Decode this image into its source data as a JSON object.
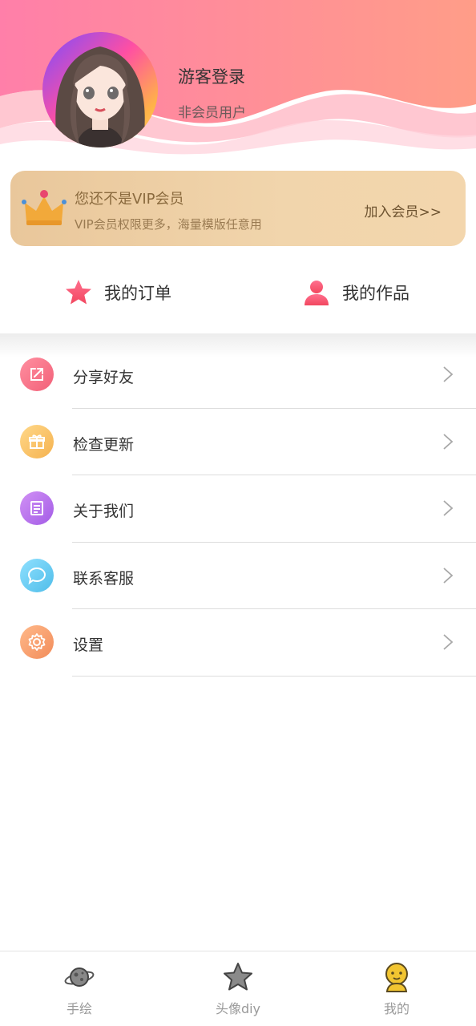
{
  "profile": {
    "name": "游客登录",
    "membership": "非会员用户"
  },
  "vip": {
    "title": "您还不是VIP会员",
    "subtitle": "VIP会员权限更多，海量模版任意用",
    "join_label": "加入会员>>"
  },
  "quick_actions": [
    {
      "label": "我的订单",
      "icon": "star-icon"
    },
    {
      "label": "我的作品",
      "icon": "person-icon"
    }
  ],
  "menu": [
    {
      "label": "分享好友",
      "icon": "share-icon",
      "color": "#f47a8d"
    },
    {
      "label": "检查更新",
      "icon": "gift-icon",
      "color": "#f7c46b"
    },
    {
      "label": "关于我们",
      "icon": "document-icon",
      "color": "#b676ec"
    },
    {
      "label": "联系客服",
      "icon": "chat-bubble-icon",
      "color": "#6fcdf2"
    },
    {
      "label": "设置",
      "icon": "gear-icon",
      "color": "#f6a36b"
    }
  ],
  "bottom_nav": [
    {
      "label": "手绘",
      "icon": "planet-icon",
      "active": false
    },
    {
      "label": "头像diy",
      "icon": "star-icon",
      "active": false
    },
    {
      "label": "我的",
      "icon": "character-icon",
      "active": true
    }
  ],
  "colors": {
    "header_gradient_start": "#ff7fa6",
    "header_gradient_end": "#ff9a8a",
    "vip_card": "#efcfa3",
    "accent_pink": "#f25a7e"
  }
}
